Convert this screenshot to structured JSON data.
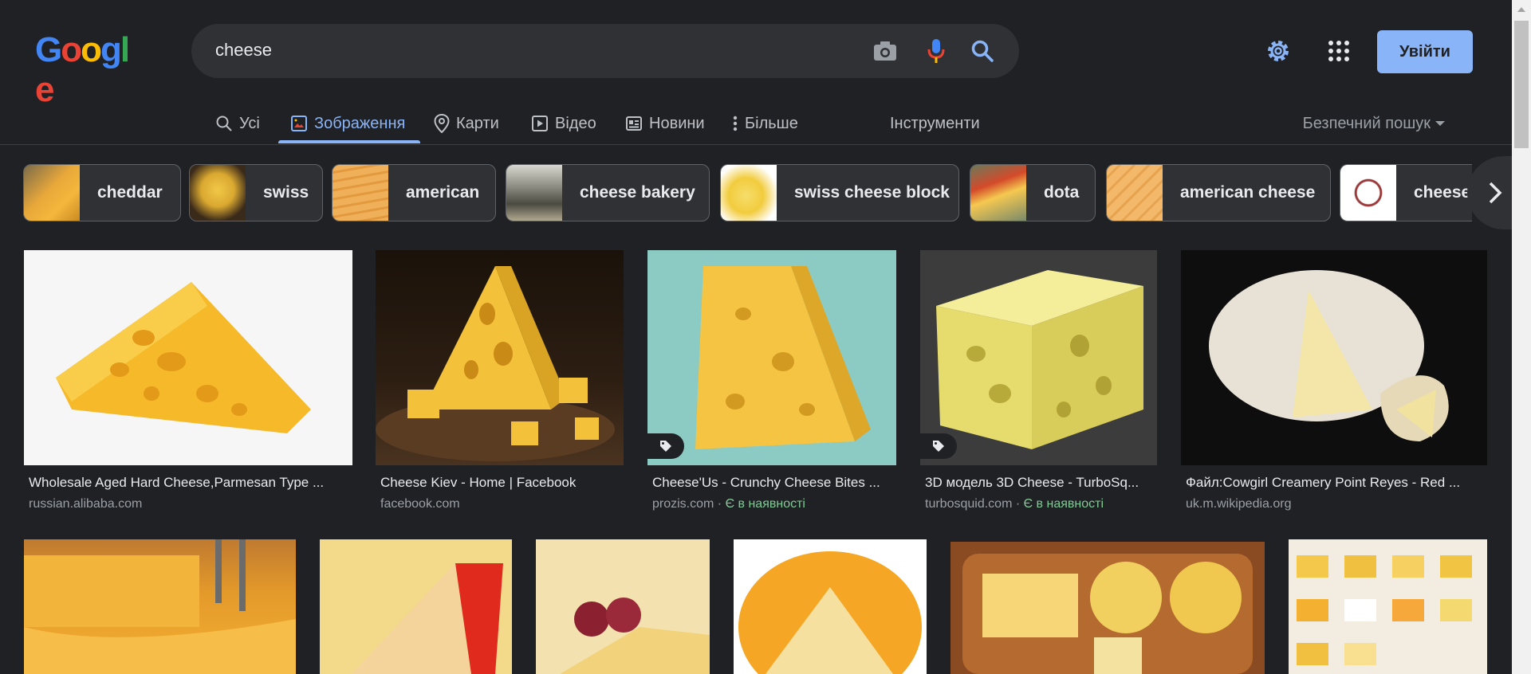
{
  "search": {
    "query": "cheese"
  },
  "header": {
    "login_label": "Увійти"
  },
  "tabs": [
    {
      "label": "Усі"
    },
    {
      "label": "Зображення"
    },
    {
      "label": "Карти"
    },
    {
      "label": "Відео"
    },
    {
      "label": "Новини"
    },
    {
      "label": "Більше"
    }
  ],
  "tools_label": "Інструменти",
  "safe_search_label": "Безпечний пошук",
  "chips": [
    {
      "label": "cheddar"
    },
    {
      "label": "swiss"
    },
    {
      "label": "american"
    },
    {
      "label": "cheese bakery"
    },
    {
      "label": "swiss cheese block"
    },
    {
      "label": "dota"
    },
    {
      "label": "american cheese"
    },
    {
      "label": "cheese"
    }
  ],
  "results": [
    {
      "title": "Wholesale Aged Hard Cheese,Parmesan Type ...",
      "source": "russian.alibaba.com",
      "availability": ""
    },
    {
      "title": "Cheese Kiev - Home | Facebook",
      "source": "facebook.com",
      "availability": ""
    },
    {
      "title": "Cheese'Us - Crunchy Cheese Bites ...",
      "source": "prozis.com",
      "availability": "Є в наявності"
    },
    {
      "title": "3D модель 3D Cheese - TurboSq...",
      "source": "turbosquid.com",
      "availability": "Є в наявності"
    },
    {
      "title": "Файл:Cowgirl Creamery Point Reyes - Red ...",
      "source": "uk.m.wikipedia.org",
      "availability": ""
    }
  ],
  "colors": {
    "accent": "#8ab4f8",
    "background": "#202124",
    "availability": "#81c995"
  }
}
